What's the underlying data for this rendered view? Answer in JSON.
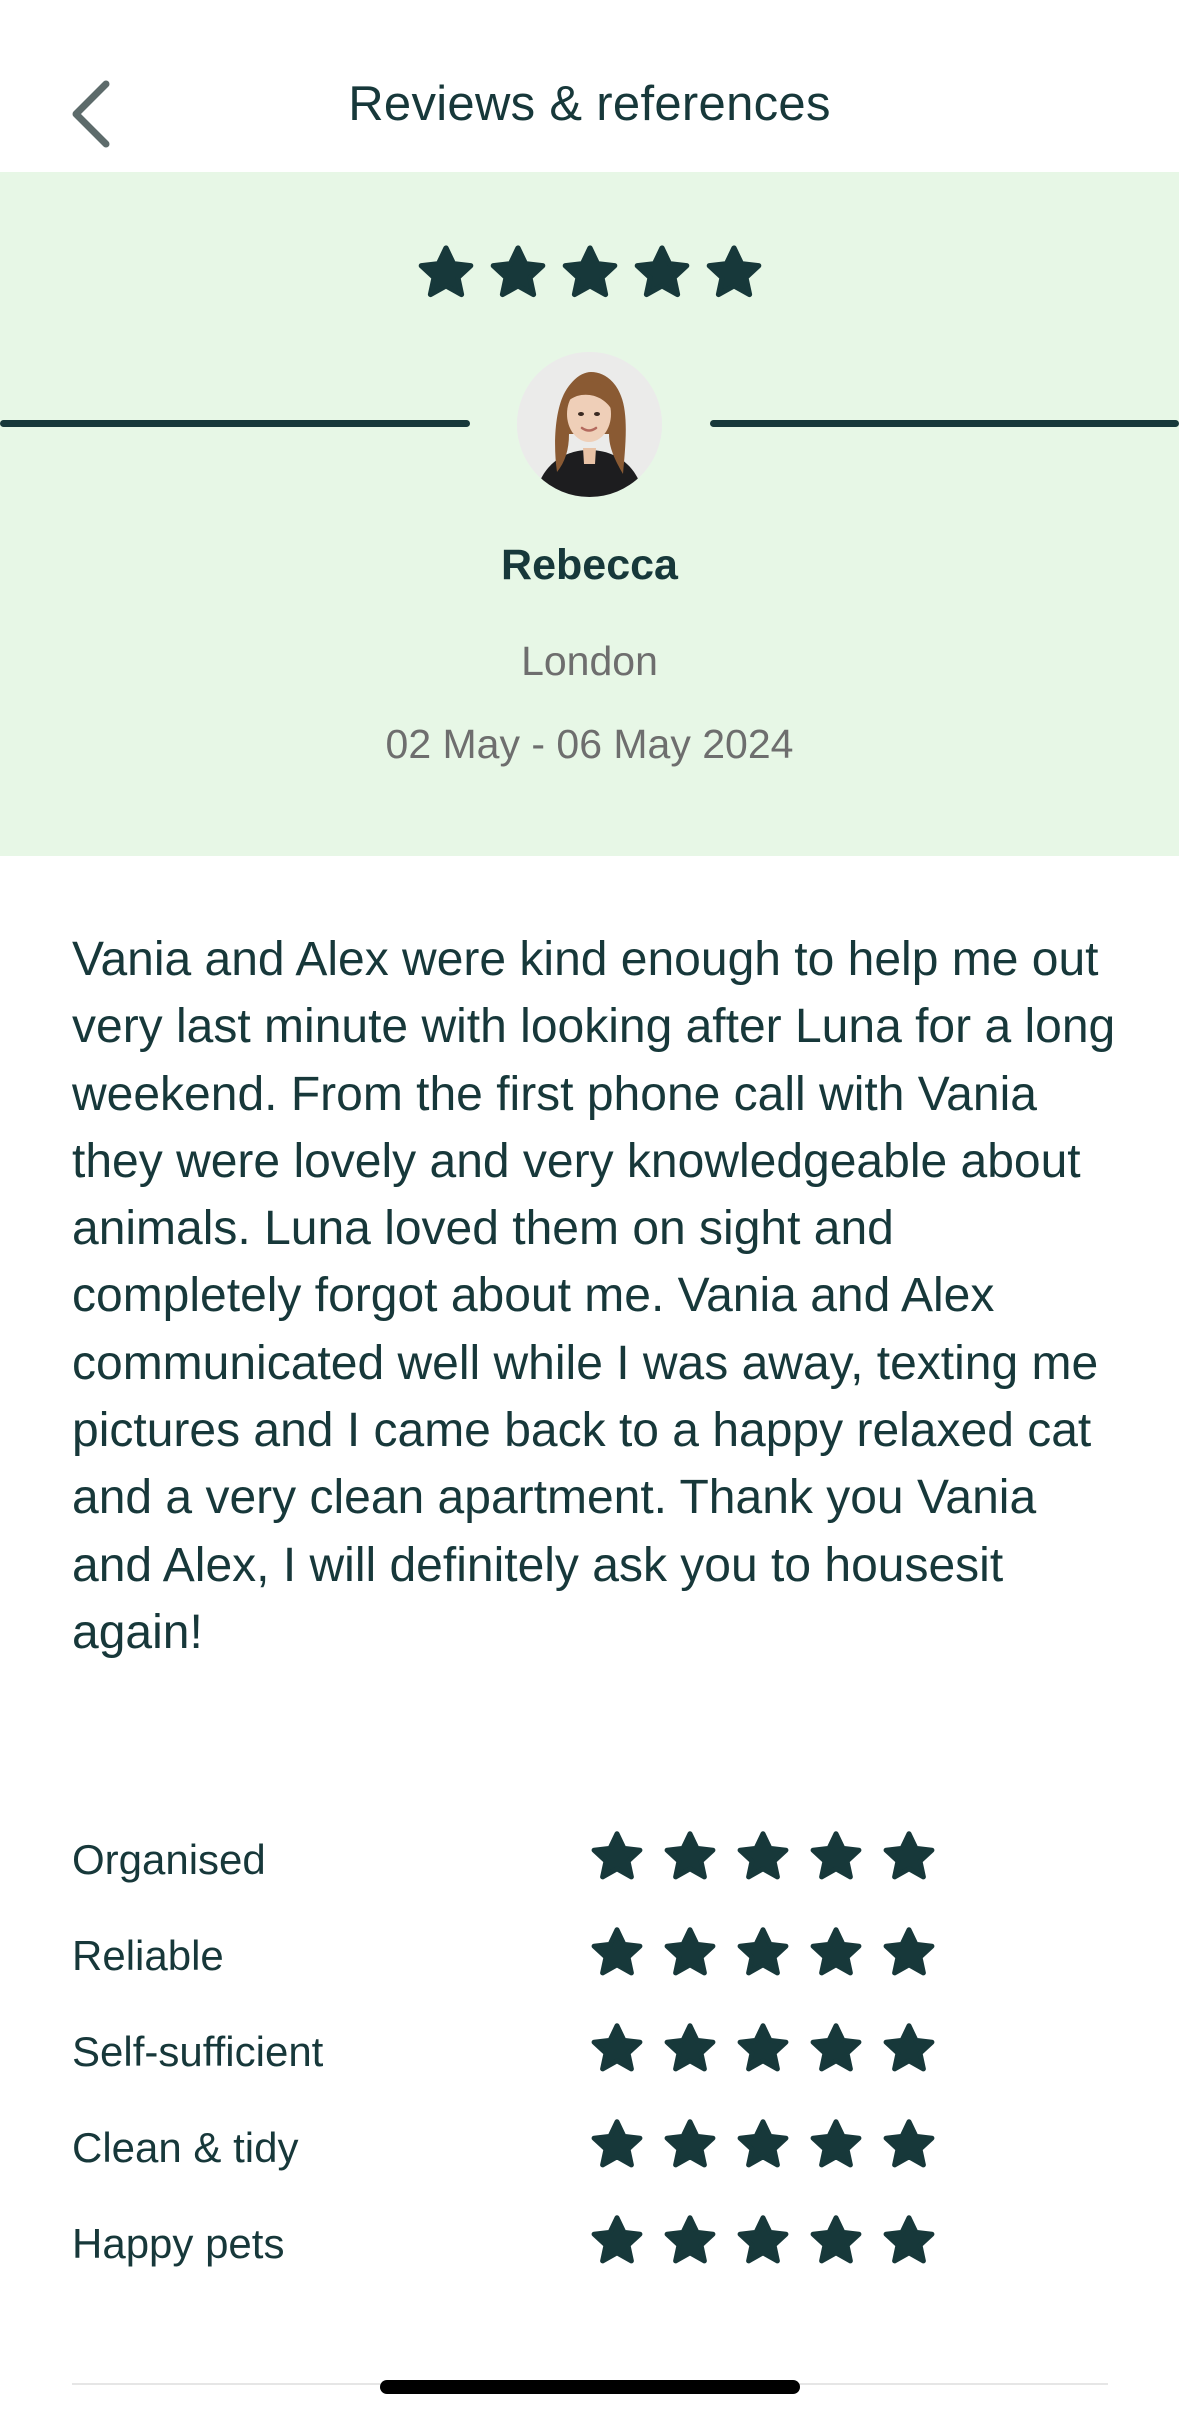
{
  "header": {
    "title": "Reviews & references",
    "back_icon": "chevron-left-icon"
  },
  "review": {
    "overall_rating": 5,
    "max_rating": 5,
    "reviewer": {
      "name": "Rebecca",
      "location": "London",
      "dates": "02 May - 06 May 2024"
    },
    "text": "Vania and Alex were kind enough to help me out very last minute with looking after Luna for a long weekend. From the first phone call with Vania they were lovely and very knowledgeable about animals. Luna loved them on sight and completely forgot about me. Vania and Alex communicated well while I was away, texting me pictures and I came back to a happy relaxed cat and a very clean apartment. Thank you Vania and Alex, I will definitely ask you to housesit again!",
    "criteria": [
      {
        "label": "Organised",
        "rating": 5
      },
      {
        "label": "Reliable",
        "rating": 5
      },
      {
        "label": "Self-sufficient",
        "rating": 5
      },
      {
        "label": "Clean & tidy",
        "rating": 5
      },
      {
        "label": "Happy pets",
        "rating": 5
      }
    ]
  },
  "colors": {
    "brand_dark": "#17383a",
    "hero_background": "#e7f7e6",
    "muted_text": "#6e6e6e"
  }
}
